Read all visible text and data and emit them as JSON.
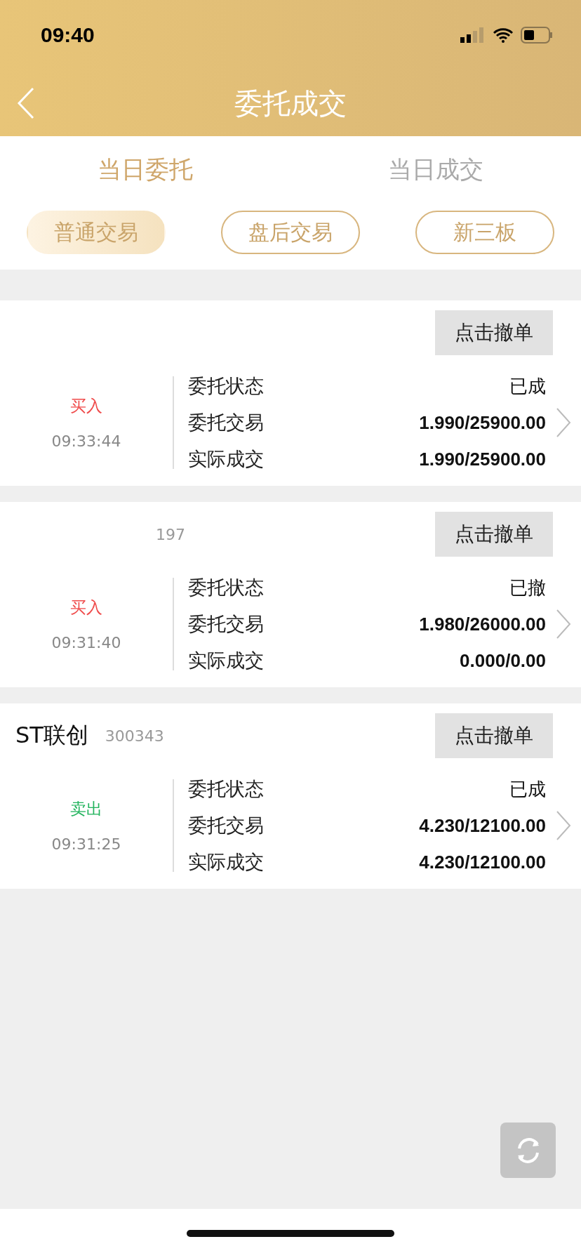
{
  "status_bar": {
    "time": "09:40"
  },
  "header": {
    "title": "委托成交"
  },
  "tabs": [
    {
      "label": "当日委托",
      "selected": true
    },
    {
      "label": "当日成交",
      "selected": false
    }
  ],
  "filters": [
    {
      "label": "普通交易",
      "selected": true
    },
    {
      "label": "盘后交易",
      "selected": false
    },
    {
      "label": "新三板",
      "selected": false
    }
  ],
  "orders": [
    {
      "button": "点击撤单",
      "side": "买入",
      "kind": "buy",
      "time": "09:33:44",
      "fields": [
        {
          "label": "委托状态",
          "value": "已成"
        },
        {
          "label": "委托交易",
          "value": "1.990/25900.00"
        },
        {
          "label": "实际成交",
          "value": "1.990/25900.00"
        }
      ]
    },
    {
      "code": "197",
      "button": "点击撤单",
      "side": "买入",
      "kind": "buy",
      "time": "09:31:40",
      "fields": [
        {
          "label": "委托状态",
          "value": "已撤"
        },
        {
          "label": "委托交易",
          "value": "1.980/26000.00"
        },
        {
          "label": "实际成交",
          "value": "0.000/0.00"
        }
      ]
    },
    {
      "name": "ST联创",
      "code": "300343",
      "button": "点击撤单",
      "side": "卖出",
      "kind": "sell",
      "time": "09:31:25",
      "fields": [
        {
          "label": "委托状态",
          "value": "已成"
        },
        {
          "label": "委托交易",
          "value": "4.230/12100.00"
        },
        {
          "label": "实际成交",
          "value": "4.230/12100.00"
        }
      ]
    }
  ]
}
